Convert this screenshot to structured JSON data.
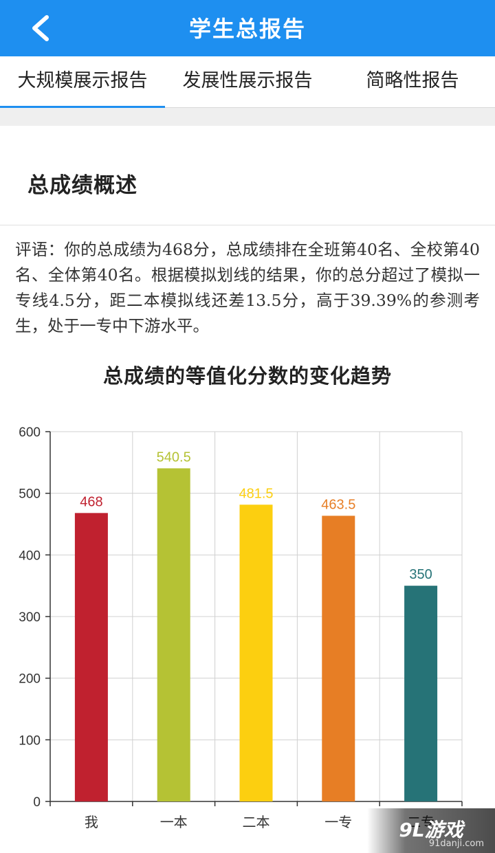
{
  "header": {
    "title": "学生总报告",
    "back_icon": "chevron-left-icon",
    "background": "#1e8ff0"
  },
  "tabs": [
    {
      "label": "大规模展示报告",
      "active": true
    },
    {
      "label": "发展性展示报告",
      "active": false
    },
    {
      "label": "简略性报告",
      "active": false
    }
  ],
  "section": {
    "title": "总成绩概述",
    "comment": "评语：你的总成绩为468分，总成绩排在全班第40名、全校第40名、全体第40名。根据模拟划线的结果，你的总分超过了模拟一专线4.5分，距二本模拟线还差13.5分，高于39.39%的参测考生，处于一专中下游水平。"
  },
  "chart_data": {
    "type": "bar",
    "title": "总成绩的等值化分数的变化趋势",
    "categories": [
      "我",
      "一本",
      "二本",
      "一专",
      "二专"
    ],
    "values": [
      468,
      540.5,
      481.5,
      463.5,
      350
    ],
    "value_labels": [
      "468",
      "540.5",
      "481.5",
      "463.5",
      "350"
    ],
    "colors": [
      "#c0212f",
      "#b5c234",
      "#fccf10",
      "#e77e25",
      "#267377"
    ],
    "ylim": [
      0,
      600
    ],
    "yticks": [
      0,
      100,
      200,
      300,
      400,
      500,
      600
    ],
    "grid": true
  },
  "watermark": {
    "logo": "9L游戏",
    "url": "91danji.com"
  }
}
